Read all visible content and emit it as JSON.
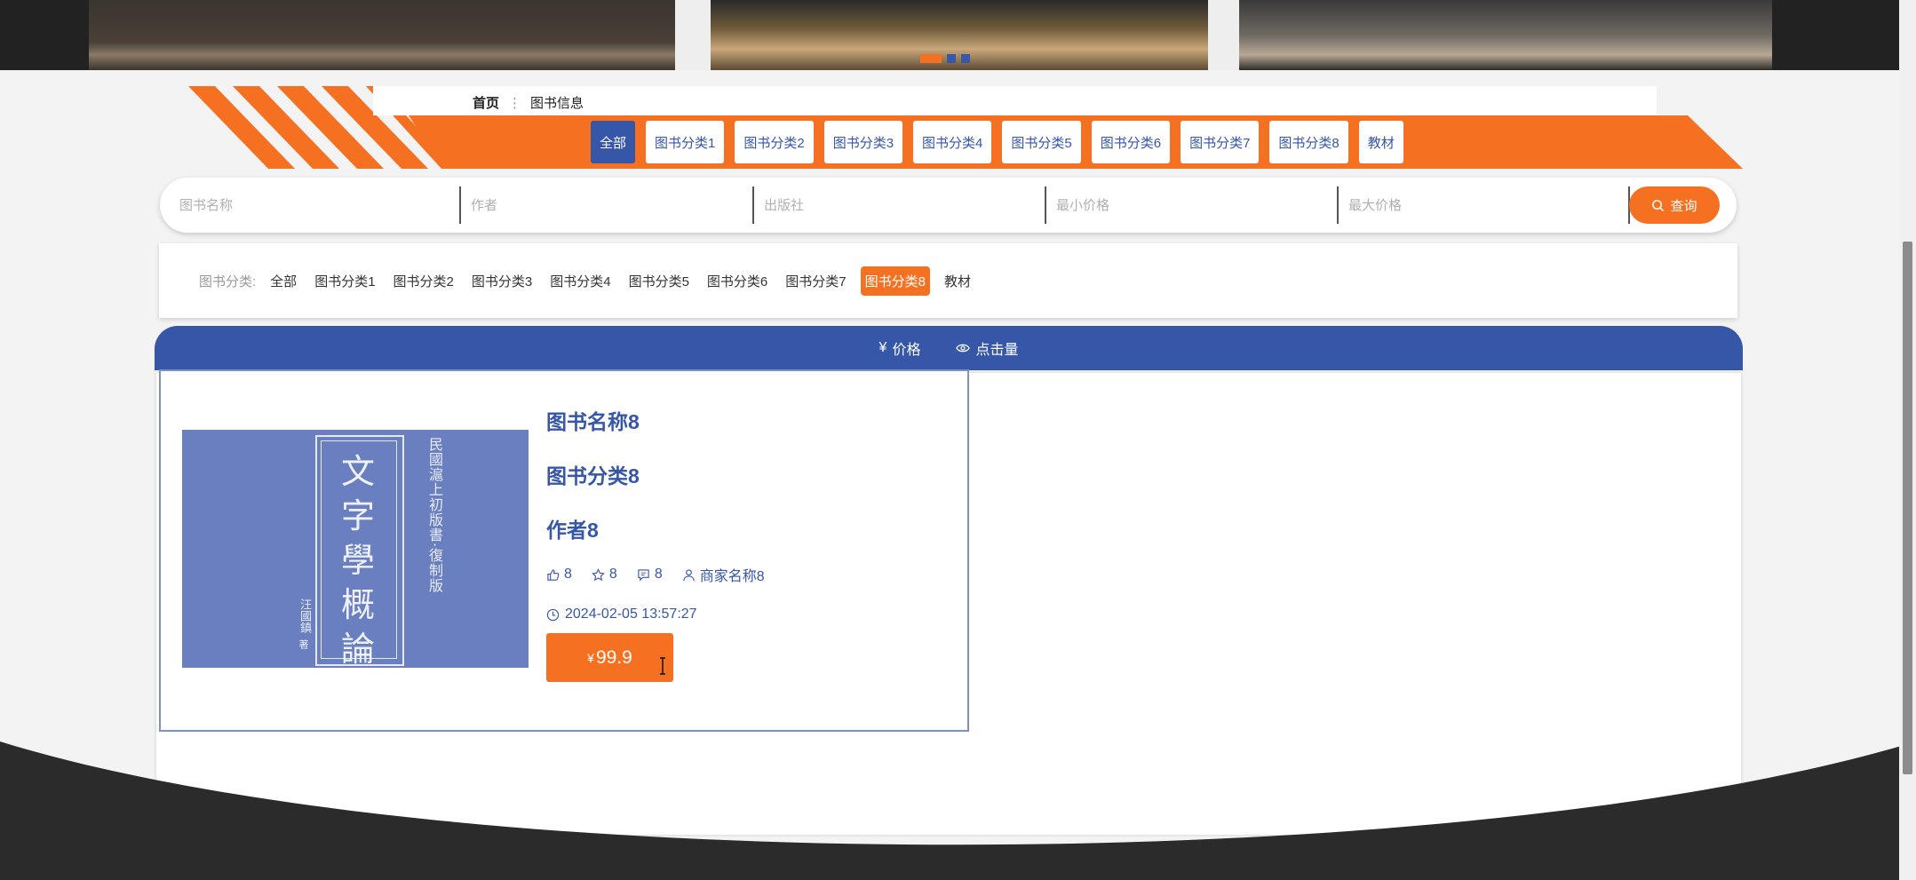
{
  "banner": {
    "carousel_slides": 3,
    "active_slide": 1
  },
  "breadcrumb": {
    "home": "首页",
    "separator": "⋮",
    "current": "图书信息"
  },
  "category_tabs": [
    "全部",
    "图书分类1",
    "图书分类2",
    "图书分类3",
    "图书分类4",
    "图书分类5",
    "图书分类6",
    "图书分类7",
    "图书分类8",
    "教材"
  ],
  "active_category_tab": "全部",
  "search": {
    "book_name_placeholder": "图书名称",
    "author_placeholder": "作者",
    "publisher_placeholder": "出版社",
    "min_price_placeholder": "最小价格",
    "max_price_placeholder": "最大价格",
    "button_label": "查询"
  },
  "filter": {
    "label": "图书分类:",
    "items": [
      "全部",
      "图书分类1",
      "图书分类2",
      "图书分类3",
      "图书分类4",
      "图书分类5",
      "图书分类6",
      "图书分类7",
      "图书分类8",
      "教材"
    ],
    "active": "图书分类8"
  },
  "sort": {
    "price_symbol": "¥",
    "price_label": "价格",
    "clicks_label": "点击量"
  },
  "product": {
    "name": "图书名称8",
    "category": "图书分类8",
    "author": "作者8",
    "likes": "8",
    "favorites": "8",
    "comments": "8",
    "merchant": "商家名称8",
    "time": "2024-02-05 13:57:27",
    "price_symbol": "¥",
    "price": "99.9",
    "cover": {
      "title_chars": [
        "文",
        "字",
        "學",
        "概",
        "論"
      ],
      "side_text": "民國滬上初版書·復制版",
      "author_text": "汪國鎮",
      "author_suffix": "著"
    }
  },
  "colors": {
    "orange": "#f57021",
    "blue": "#3656a8",
    "cover_blue": "#6a7fc0"
  }
}
